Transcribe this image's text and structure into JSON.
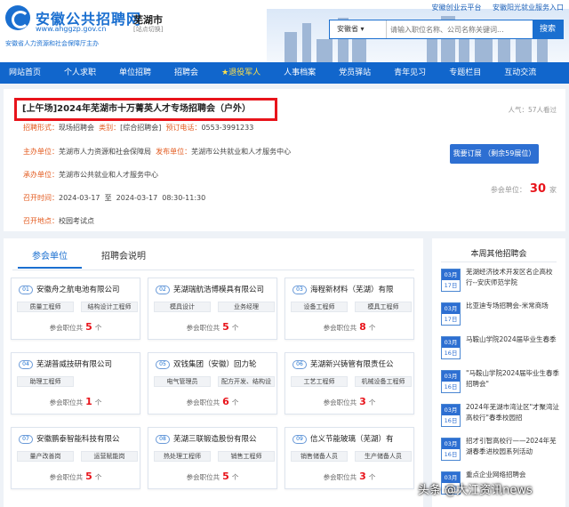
{
  "header": {
    "title": "安徽公共招聘网",
    "url": "www.ahggzp.gov.cn",
    "sub": "安徽省人力资源和社会保障厅主办",
    "city": "芜湖市",
    "city_sub": "[站点切换]",
    "links": [
      "安徽创业云平台",
      "安徽阳光就业服务入口"
    ],
    "search_select": "安徽省",
    "search_placeholder": "请输入职位名称、公司名称关键词...",
    "search_button": "搜索"
  },
  "nav": [
    "网站首页",
    "个人求职",
    "单位招聘",
    "招聘会",
    "★退役军人",
    "人事档案",
    "党员驿站",
    "青年见习",
    "专题栏目",
    "互动交流"
  ],
  "fair": {
    "title": "[上午场]2024年芜湖市十万菁英人才专场招聘会（户外）",
    "popularity": "人气：57人看过",
    "r1": {
      "l1": "招聘形式：",
      "v1": "现场招聘会",
      "l2": "类别：",
      "v2": "[综合招聘会]",
      "l3": "预订电话：",
      "v3": "0553-3991233"
    },
    "r2": {
      "l1": "主办单位：",
      "v1": "芜湖市人力资源和社会保障局",
      "l2": "发布单位：",
      "v2": "芜湖市公共就业和人才服务中心"
    },
    "r3": {
      "l1": "承办单位：",
      "v1": "芜湖市公共就业和人才服务中心"
    },
    "r4": {
      "l1": "召开时间：",
      "v1": "2024-03-17  至  2024-03-17  08:30-11:30"
    },
    "r5": {
      "l1": "召开地点：",
      "v1": "校园考试点"
    },
    "subscribe": "我要订展 （剩余59展位）",
    "count_label": "参会单位：",
    "count": "30",
    "count_unit": "家"
  },
  "tabs": [
    "参会单位",
    "招聘会说明"
  ],
  "jobs_label": "参会职位共",
  "jobs_unit": "个",
  "companies": [
    {
      "num": "01",
      "name": "安徽舟之航电池有限公司",
      "tags": [
        "质量工程师",
        "结构设计工程师"
      ],
      "jobs": "5"
    },
    {
      "num": "02",
      "name": "芜湖瑞航浩博模具有限公司",
      "tags": [
        "模具设计",
        "业务经理"
      ],
      "jobs": "5"
    },
    {
      "num": "03",
      "name": "海程新材料（芜湖）有限",
      "tags": [
        "设备工程师",
        "模具工程师"
      ],
      "jobs": "8"
    },
    {
      "num": "04",
      "name": "芜湖普威技研有限公司",
      "tags": [
        "助理工程师"
      ],
      "jobs": "1"
    },
    {
      "num": "05",
      "name": "双钱集团（安徽）回力轮",
      "tags": [
        "电气管理员",
        "配方开发、结构设"
      ],
      "jobs": "6"
    },
    {
      "num": "06",
      "name": "芜湖新兴铸管有限责任公",
      "tags": [
        "工艺工程师",
        "机械设备工程师"
      ],
      "jobs": "3"
    },
    {
      "num": "07",
      "name": "安徽鹏泰智能科技有限公",
      "tags": [
        "量产改善岗",
        "运营赋能岗"
      ],
      "jobs": "5"
    },
    {
      "num": "08",
      "name": "芜湖三联锻造股份有限公",
      "tags": [
        "热处理工程师",
        "销售工程师"
      ],
      "jobs": "5"
    },
    {
      "num": "09",
      "name": "信义节能玻璃（芜湖）有",
      "tags": [
        "销售储备人员",
        "生产储备人员"
      ],
      "jobs": "3"
    }
  ],
  "sidebar": {
    "title": "本周其他招聘会",
    "items": [
      {
        "month": "03月",
        "day": "17日",
        "title": "芜湖经济技术开发区名企高校行--安庆师范学院"
      },
      {
        "month": "03月",
        "day": "17日",
        "title": "比亚迪专场招聘会-米常商场"
      },
      {
        "month": "03月",
        "day": "16日",
        "title": "马鞍山学院2024届毕业生春季"
      },
      {
        "month": "03月",
        "day": "16日",
        "title": "\"马鞍山学院2024届毕业生春季招聘会\""
      },
      {
        "month": "03月",
        "day": "16日",
        "title": "2024年芜湖市湾沚区\"才聚湾沚高校行\"春季校园招"
      },
      {
        "month": "03月",
        "day": "16日",
        "title": "招才引智高校行——2024年芜湖春季进校园系列活动"
      },
      {
        "month": "03月",
        "day": "16日",
        "title": "重点企业网络招聘会"
      }
    ]
  },
  "watermark": "头条 @大江资讯news"
}
